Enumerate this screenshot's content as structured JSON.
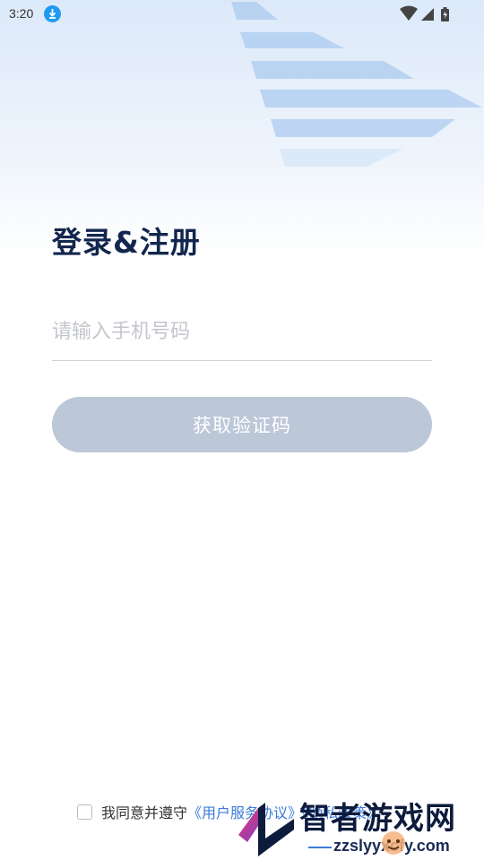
{
  "status_bar": {
    "time": "3:20",
    "icons": [
      "download-icon",
      "wifi-icon",
      "signal-icon",
      "battery-icon"
    ]
  },
  "title": "登录&注册",
  "phone": {
    "placeholder": "请输入手机号码",
    "value": ""
  },
  "get_code_button": "获取验证码",
  "agreement": {
    "checked": false,
    "prefix": "我同意并遵守",
    "links_text": "《用户服务协议》《隐私政策》"
  },
  "watermark": {
    "brand": "智者游戏网",
    "url": "zzslyyxcfy.com"
  },
  "colors": {
    "accent": "#3b7bd8",
    "button_disabled": "#bcc7d8",
    "title": "#13264d"
  }
}
